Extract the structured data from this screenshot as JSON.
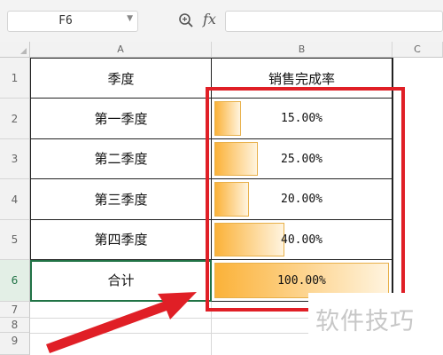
{
  "name_box": {
    "value": "F6"
  },
  "formula_bar": {
    "fx_label": "fx",
    "value": ""
  },
  "columns": [
    "A",
    "B",
    "C"
  ],
  "rows": [
    "1",
    "2",
    "3",
    "4",
    "5",
    "6",
    "7",
    "8",
    "9"
  ],
  "table": {
    "header": {
      "a": "季度",
      "b": "销售完成率"
    },
    "data": [
      {
        "a": "第一季度",
        "b": "15.00%",
        "pct": 15
      },
      {
        "a": "第二季度",
        "b": "25.00%",
        "pct": 25
      },
      {
        "a": "第三季度",
        "b": "20.00%",
        "pct": 20
      },
      {
        "a": "第四季度",
        "b": "40.00%",
        "pct": 40
      },
      {
        "a": "合计",
        "b": "100.00%",
        "pct": 100
      }
    ]
  },
  "watermark": "软件技巧",
  "colors": {
    "bar_start": "#fbb239",
    "highlight": "#e01f26",
    "selection": "#217346"
  }
}
